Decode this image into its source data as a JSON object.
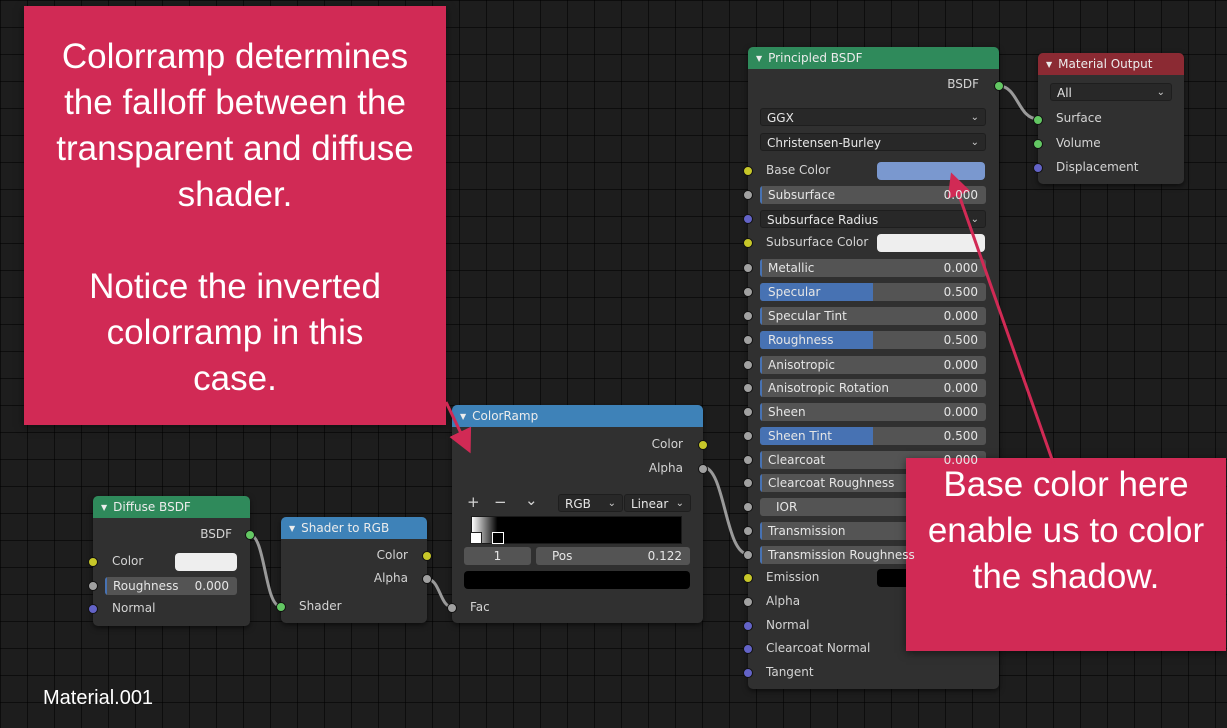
{
  "annotations": {
    "left_callout_line1": "Colorramp determines the falloff between the transparent and diffuse shader.",
    "left_callout_line2": "Notice the inverted colorramp in this case.",
    "right_callout": "Base color here enable us to color the shadow."
  },
  "material_name": "Material.001",
  "nodes": {
    "diffuse_bsdf": {
      "title": "Diffuse BSDF",
      "output": "BSDF",
      "color_label": "Color",
      "roughness_label": "Roughness",
      "roughness_value": "0.000",
      "normal_label": "Normal",
      "swatch_color": "#eeeeee"
    },
    "shader_to_rgb": {
      "title": "Shader to RGB",
      "out_color": "Color",
      "out_alpha": "Alpha",
      "in_shader": "Shader"
    },
    "color_ramp": {
      "title": "ColorRamp",
      "out_color": "Color",
      "out_alpha": "Alpha",
      "add_icon": "+",
      "remove_icon": "−",
      "menu_icon": "⌄",
      "color_mode": "RGB",
      "interpolation": "Linear",
      "stop_index": "1",
      "pos_label": "Pos",
      "pos_value": "0.122",
      "in_fac": "Fac"
    },
    "principled_bsdf": {
      "title": "Principled BSDF",
      "output": "BSDF",
      "distribution": "GGX",
      "subsurface_method": "Christensen-Burley",
      "base_color_label": "Base Color",
      "base_color_swatch": "#7a98cf",
      "subsurface_label": "Subsurface",
      "subsurface_value": "0.000",
      "subsurface_radius_label": "Subsurface Radius",
      "subsurface_color_label": "Subsurface Color",
      "metallic_label": "Metallic",
      "metallic_value": "0.000",
      "specular_label": "Specular",
      "specular_value": "0.500",
      "specular_tint_label": "Specular Tint",
      "specular_tint_value": "0.000",
      "roughness_label": "Roughness",
      "roughness_value": "0.500",
      "anisotropic_label": "Anisotropic",
      "anisotropic_value": "0.000",
      "anisotropic_rotation_label": "Anisotropic Rotation",
      "anisotropic_rotation_value": "0.000",
      "sheen_label": "Sheen",
      "sheen_value": "0.000",
      "sheen_tint_label": "Sheen Tint",
      "sheen_tint_value": "0.500",
      "clearcoat_label": "Clearcoat",
      "clearcoat_value": "0.000",
      "clearcoat_roughness_label": "Clearcoat Roughness",
      "ior_label": "IOR",
      "transmission_label": "Transmission",
      "transmission_roughness_label": "Transmission Roughness",
      "emission_label": "Emission",
      "alpha_label": "Alpha",
      "normal_label": "Normal",
      "clearcoat_normal_label": "Clearcoat Normal",
      "tangent_label": "Tangent"
    },
    "material_output": {
      "title": "Material Output",
      "target": "All",
      "surface_label": "Surface",
      "volume_label": "Volume",
      "displacement_label": "Displacement"
    }
  },
  "colors": {
    "callout": "#d12a55",
    "header_shader": "#2f8a5b",
    "header_converter": "#3e82b8",
    "header_output": "#8b2a33",
    "slider_fill": "#4772b3"
  }
}
